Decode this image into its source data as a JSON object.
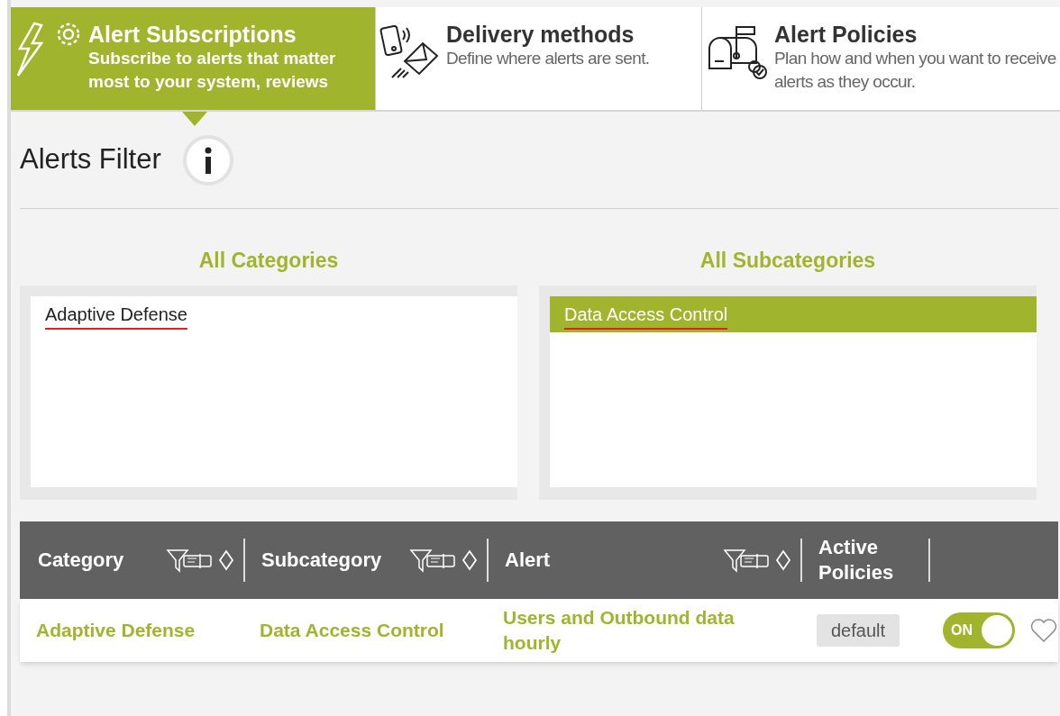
{
  "tabs": [
    {
      "kind": "subscriptions",
      "title": "Alert Subscriptions",
      "subtitle": "Subscribe to alerts that matter most to your system, reviews",
      "selected": true
    },
    {
      "kind": "delivery",
      "title": "Delivery methods",
      "subtitle": "Define where alerts are sent.",
      "selected": false
    },
    {
      "kind": "policies",
      "title": "Alert Policies",
      "subtitle": "Plan how and when you want to receive alerts as they occur.",
      "selected": false
    }
  ],
  "filter": {
    "title": "Alerts Filter",
    "lists": [
      {
        "heading": "All Categories",
        "items": [
          {
            "label": "Adaptive Defense",
            "selected": false
          }
        ]
      },
      {
        "heading": "All Subcategories",
        "items": [
          {
            "label": "Data Access Control",
            "selected": true
          }
        ]
      }
    ]
  },
  "table": {
    "columns": [
      {
        "label": "Category",
        "filterable": true
      },
      {
        "label": "Subcategory",
        "filterable": true
      },
      {
        "label": "Alert",
        "filterable": true
      },
      {
        "label": "Active Policies",
        "filterable": false
      }
    ],
    "rows": [
      {
        "category": "Adaptive Defense",
        "subcategory": "Data Access Control",
        "alert": "Users and Outbound data hourly",
        "policy": "default",
        "toggle": "ON",
        "on": true,
        "favorite": false
      }
    ]
  }
}
